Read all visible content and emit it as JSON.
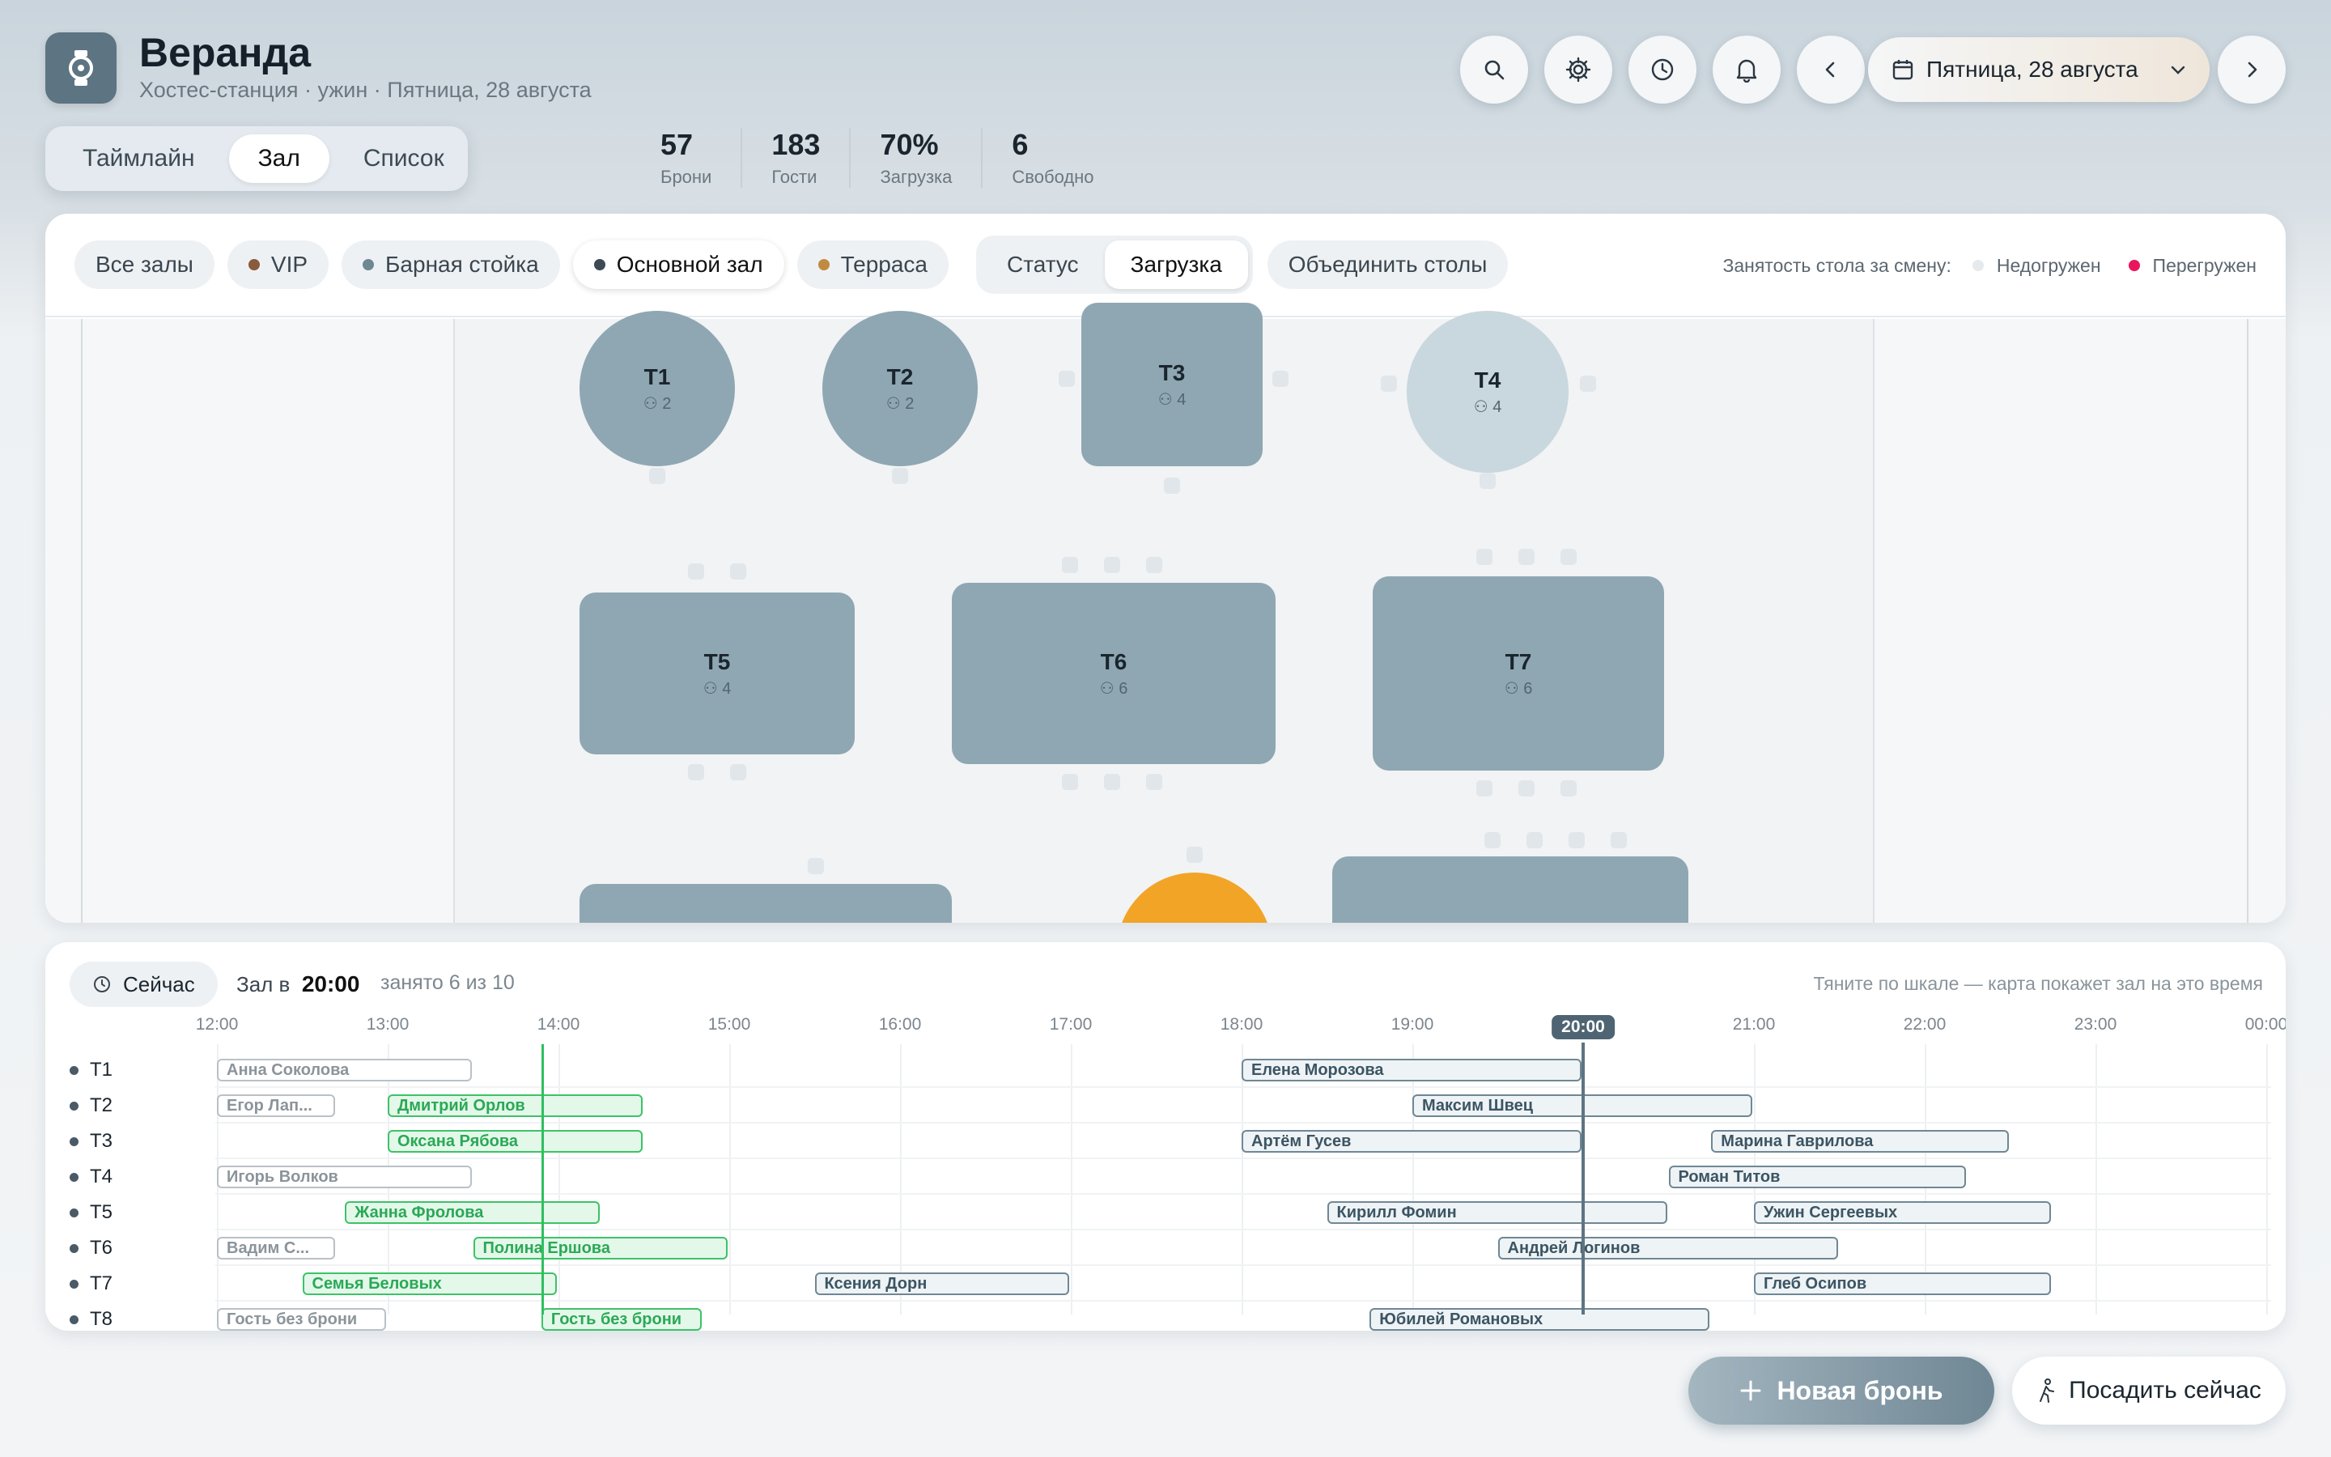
{
  "header": {
    "title": "Веранда",
    "subtitle": "Хостес-станция · ужин · Пятница, 28 августа"
  },
  "view_tabs": [
    {
      "label": "Таймлайн"
    },
    {
      "label": "Зал",
      "active": true
    },
    {
      "label": "Список"
    }
  ],
  "stats": [
    {
      "value": "57",
      "label": "Брони"
    },
    {
      "value": "183",
      "label": "Гости"
    },
    {
      "value": "70%",
      "label": "Загрузка"
    },
    {
      "value": "6",
      "label": "Свободно"
    }
  ],
  "date": {
    "label": "Пятница, 28 августа"
  },
  "icons": {
    "logo": "watch-icon",
    "search": "search-icon",
    "settings": "gear-icon",
    "history": "clock-icon",
    "notify": "bell-icon",
    "prev": "chevron-left-icon",
    "next": "chevron-right-icon",
    "calendar": "calendar-icon",
    "dropdown": "chevron-down-icon"
  },
  "halls": [
    {
      "label": "Все залы",
      "color": ""
    },
    {
      "label": "VIP",
      "color": "#8a5a3c"
    },
    {
      "label": "Барная стойка",
      "color": "#6f8794"
    },
    {
      "label": "Основной зал",
      "color": "#3c4a55",
      "active": true
    },
    {
      "label": "Терраса",
      "color": "#c08a40"
    }
  ],
  "mode": [
    {
      "label": "Статус"
    },
    {
      "label": "Загрузка",
      "active": true
    }
  ],
  "merge_label": "Объединить столы",
  "legend": {
    "title": "Занятость стола за смену:",
    "low": "Недогружен",
    "high": "Перегружен",
    "low_color": "#e6eaed",
    "high_color": "#e8175d"
  },
  "colors": {
    "table": "#8fa7b3",
    "table_light": "#c9d7de",
    "table_busy": "#f2a427",
    "accent": "#5d7482",
    "active_green": "#2ebf5f"
  },
  "tables": [
    {
      "id": "T1",
      "name": "T1",
      "seats": "2"
    },
    {
      "id": "T2",
      "name": "T2",
      "seats": "2"
    },
    {
      "id": "T3",
      "name": "T3",
      "seats": "4"
    },
    {
      "id": "T4",
      "name": "T4",
      "seats": "4"
    },
    {
      "id": "T5",
      "name": "T5",
      "seats": "4"
    },
    {
      "id": "T6",
      "name": "T6",
      "seats": "6"
    },
    {
      "id": "T7",
      "name": "T7",
      "seats": "6"
    }
  ],
  "timeline": {
    "now_label": "Сейчас",
    "hall_at_prefix": "Зал в",
    "hall_at_time": "20:00",
    "occupancy": "занято 6 из 10",
    "hint": "Тяните по шкале — карта покажет зал на это время",
    "hours": [
      "12:00",
      "13:00",
      "14:00",
      "15:00",
      "16:00",
      "17:00",
      "18:00",
      "19:00",
      "20:00",
      "21:00",
      "22:00",
      "23:00",
      "00:00"
    ],
    "now_time": 13.9,
    "selected_time": 20.0,
    "rows": [
      {
        "label": "T1",
        "bookings": [
          {
            "name": "Анна Соколова",
            "start": 12.0,
            "end": 13.5,
            "state": "past"
          },
          {
            "name": "Елена Морозова",
            "start": 18.0,
            "end": 20.0,
            "state": "future"
          }
        ]
      },
      {
        "label": "T2",
        "bookings": [
          {
            "name": "Егор Лап...",
            "start": 12.0,
            "end": 12.7,
            "state": "past"
          },
          {
            "name": "Дмитрий Орлов",
            "start": 13.0,
            "end": 14.5,
            "state": "active"
          },
          {
            "name": "Максим Швец",
            "start": 19.0,
            "end": 21.0,
            "state": "future"
          }
        ]
      },
      {
        "label": "T3",
        "bookings": [
          {
            "name": "Оксана Рябова",
            "start": 13.0,
            "end": 14.5,
            "state": "active"
          },
          {
            "name": "Артём Гусев",
            "start": 18.0,
            "end": 20.0,
            "state": "future"
          },
          {
            "name": "Марина Гаврилова",
            "start": 20.75,
            "end": 22.5,
            "state": "future"
          }
        ]
      },
      {
        "label": "T4",
        "bookings": [
          {
            "name": "Игорь Волков",
            "start": 12.0,
            "end": 13.5,
            "state": "past"
          },
          {
            "name": "Роман Титов",
            "start": 20.5,
            "end": 22.25,
            "state": "future"
          }
        ]
      },
      {
        "label": "T5",
        "bookings": [
          {
            "name": "Жанна Фролова",
            "start": 12.75,
            "end": 14.25,
            "state": "active"
          },
          {
            "name": "Кирилл Фомин",
            "start": 18.5,
            "end": 20.5,
            "state": "future"
          },
          {
            "name": "Ужин Сергеевых",
            "start": 21.0,
            "end": 22.75,
            "state": "future"
          }
        ]
      },
      {
        "label": "T6",
        "bookings": [
          {
            "name": "Вадим С...",
            "start": 12.0,
            "end": 12.7,
            "state": "past"
          },
          {
            "name": "Полина Ершова",
            "start": 13.5,
            "end": 15.0,
            "state": "active"
          },
          {
            "name": "Андрей Логинов",
            "start": 19.5,
            "end": 21.5,
            "state": "future"
          }
        ]
      },
      {
        "label": "T7",
        "bookings": [
          {
            "name": "Семья Беловых",
            "start": 12.5,
            "end": 14.0,
            "state": "active"
          },
          {
            "name": "Ксения Дорн",
            "start": 15.5,
            "end": 17.0,
            "state": "future"
          },
          {
            "name": "Глеб Осипов",
            "start": 21.0,
            "end": 22.75,
            "state": "future"
          }
        ]
      },
      {
        "label": "T8",
        "bookings": [
          {
            "name": "Гость без брони",
            "start": 12.0,
            "end": 13.0,
            "state": "past"
          },
          {
            "name": "Гость без брони",
            "start": 13.9,
            "end": 14.85,
            "state": "active"
          },
          {
            "name": "Юбилей Романовых",
            "start": 18.75,
            "end": 20.75,
            "state": "future"
          }
        ]
      }
    ]
  },
  "actions": {
    "new_booking": "Новая бронь",
    "seat_now": "Посадить сейчас"
  }
}
